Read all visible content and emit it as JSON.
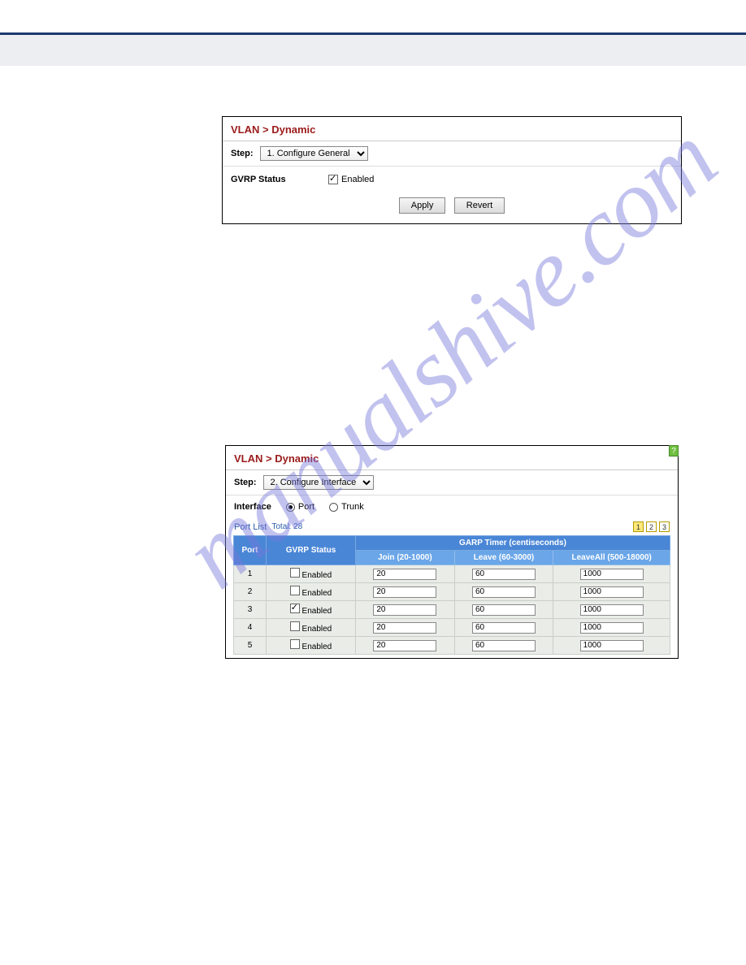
{
  "watermark": "manualshive.com",
  "panel1": {
    "title": "VLAN > Dynamic",
    "step_label": "Step:",
    "step_select": "1. Configure General",
    "gvrp_label": "GVRP Status",
    "enabled_label": "Enabled",
    "gvrp_checked": true,
    "apply_btn": "Apply",
    "revert_btn": "Revert"
  },
  "panel2": {
    "title": "VLAN > Dynamic",
    "step_label": "Step:",
    "step_select": "2. Configure Interface",
    "iface_label": "Interface",
    "radio_port": "Port",
    "radio_trunk": "Trunk",
    "portlist_label": "Port List",
    "total_label": "Total: 28",
    "pages": [
      "1",
      "2",
      "3"
    ],
    "headers": {
      "port": "Port",
      "gvrp": "GVRP Status",
      "garp": "GARP Timer (centiseconds)",
      "join": "Join (20-1000)",
      "leave": "Leave (60-3000)",
      "leaveall": "LeaveAll (500-18000)"
    },
    "enabled_label": "Enabled",
    "rows": [
      {
        "port": "1",
        "checked": false,
        "join": "20",
        "leave": "60",
        "leaveall": "1000"
      },
      {
        "port": "2",
        "checked": false,
        "join": "20",
        "leave": "60",
        "leaveall": "1000"
      },
      {
        "port": "3",
        "checked": true,
        "join": "20",
        "leave": "60",
        "leaveall": "1000"
      },
      {
        "port": "4",
        "checked": false,
        "join": "20",
        "leave": "60",
        "leaveall": "1000"
      },
      {
        "port": "5",
        "checked": false,
        "join": "20",
        "leave": "60",
        "leaveall": "1000"
      }
    ],
    "help": "?"
  }
}
